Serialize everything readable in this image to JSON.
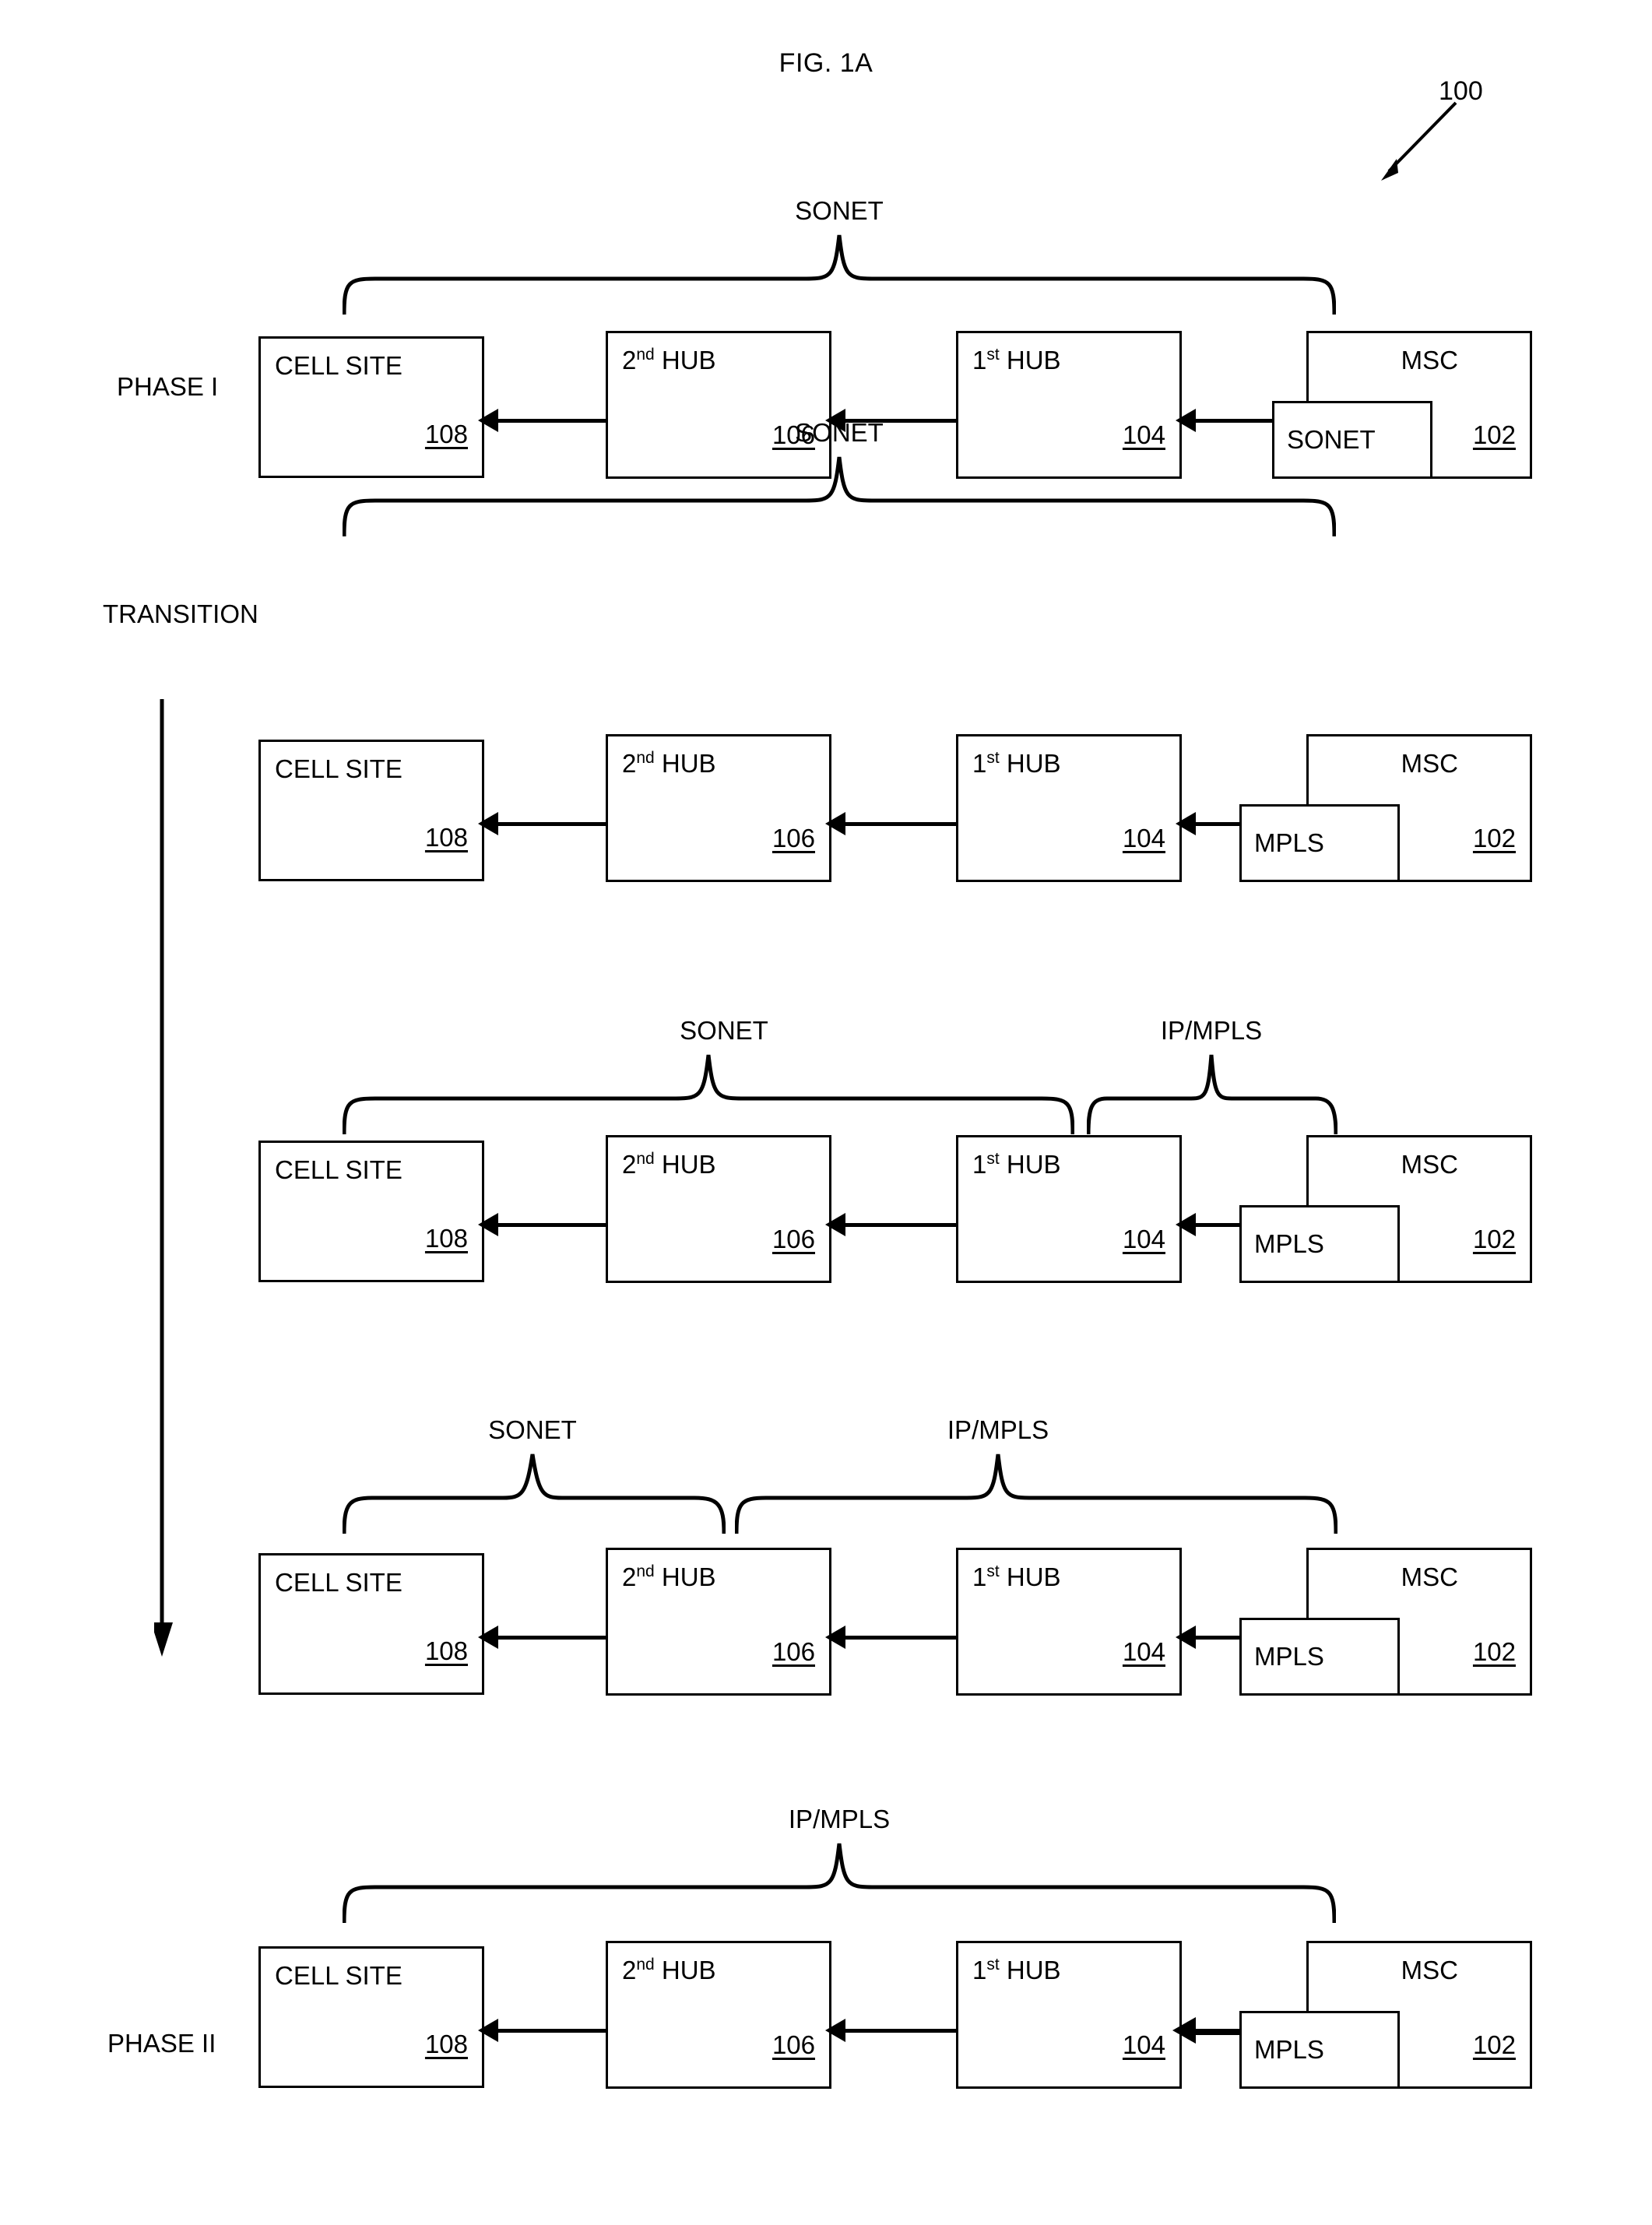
{
  "figure": {
    "title": "FIG. 1A",
    "reference_numeral": "100"
  },
  "phase_labels": {
    "phase_1": "PHASE I",
    "transition": "TRANSITION",
    "phase_2": "PHASE II"
  },
  "node_labels": {
    "cell_site": "CELL SITE",
    "second_hub_prefix": "2",
    "second_hub_sup": "nd",
    "second_hub_suffix": " HUB",
    "first_hub_prefix": "1",
    "first_hub_sup": "st",
    "first_hub_suffix": " HUB",
    "msc": "MSC"
  },
  "node_numbers": {
    "cell_site": "108",
    "second_hub": "106",
    "first_hub": "104",
    "msc": "102"
  },
  "transports": {
    "sonet": "SONET",
    "mpls": "MPLS",
    "ip_mpls": "IP/MPLS"
  },
  "rows": [
    {
      "id": "phase-1",
      "row_label": "PHASE I",
      "chip_label": "SONET",
      "braces": [
        {
          "label": "SONET",
          "start": 440,
          "end": 1716
        }
      ]
    },
    {
      "id": "transition-1",
      "row_label": "TRANSITION",
      "chip_label": "MPLS",
      "braces": [
        {
          "label": "SONET",
          "start": 440,
          "end": 1716
        }
      ]
    },
    {
      "id": "transition-2",
      "row_label": "",
      "chip_label": "MPLS",
      "braces": [
        {
          "label": "SONET",
          "start": 440,
          "end": 1380
        },
        {
          "label": "IP/MPLS",
          "start": 1396,
          "end": 1716
        }
      ]
    },
    {
      "id": "transition-3",
      "row_label": "",
      "chip_label": "MPLS",
      "braces": [
        {
          "label": "SONET",
          "start": 440,
          "end": 930
        },
        {
          "label": "IP/MPLS",
          "start": 944,
          "end": 1716
        }
      ]
    },
    {
      "id": "phase-2",
      "row_label": "PHASE II",
      "chip_label": "MPLS",
      "braces": [
        {
          "label": "IP/MPLS",
          "start": 440,
          "end": 1716
        }
      ]
    }
  ],
  "colors": {
    "line": "#000000",
    "background": "#ffffff"
  }
}
